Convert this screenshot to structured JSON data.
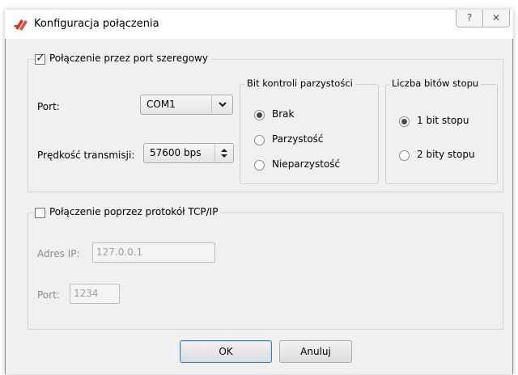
{
  "window": {
    "title": "Konfiguracja połączenia",
    "help_label": "?",
    "close_label": "✕"
  },
  "serial": {
    "enabled_label": "Połączenie przez port szeregowy",
    "enabled": true,
    "port_label": "Port:",
    "port_value": "COM1",
    "speed_label": "Prędkość transmisji:",
    "speed_value": "57600 bps",
    "parity": {
      "title": "Bit kontroli parzystości",
      "options": [
        "Brak",
        "Parzystość",
        "Nieparzystość"
      ],
      "selected": "Brak"
    },
    "stop_bits": {
      "title": "Liczba bitów stopu",
      "options": [
        "1 bit stopu",
        "2 bity stopu"
      ],
      "selected": "1 bit stopu"
    }
  },
  "tcp": {
    "enabled_label": "Połączenie poprzez protokół TCP/IP",
    "enabled": false,
    "ip_label": "Adres IP:",
    "ip_value": "127.0.0.1",
    "port_label": "Port:",
    "port_value": "1234"
  },
  "buttons": {
    "ok_label": "OK",
    "cancel_label": "Anuluj"
  },
  "icons": {
    "app": "app-logo-icon",
    "combo_arrow": "chevron-down-icon",
    "spinner": "up-down-arrows-icon"
  },
  "colors": {
    "dialog_bg": "#f0f0f0",
    "logo_red": "#d9341f",
    "default_button_border": "#3c7fb1"
  }
}
